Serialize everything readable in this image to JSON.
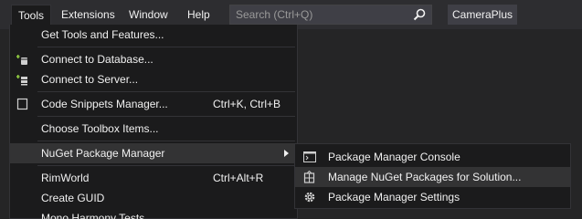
{
  "menubar": {
    "items": [
      {
        "label": "Tools"
      },
      {
        "label": "Extensions"
      },
      {
        "label": "Window"
      },
      {
        "label": "Help"
      }
    ],
    "search_placeholder": "Search (Ctrl+Q)",
    "profile_label": "CameraPlus"
  },
  "tools_menu": {
    "items": [
      {
        "label": "Get Tools and Features...",
        "shortcut": ""
      },
      {
        "label": "Connect to Database...",
        "shortcut": ""
      },
      {
        "label": "Connect to Server...",
        "shortcut": ""
      },
      {
        "label": "Code Snippets Manager...",
        "shortcut": "Ctrl+K, Ctrl+B"
      },
      {
        "label": "Choose Toolbox Items...",
        "shortcut": ""
      },
      {
        "label": "NuGet Package Manager",
        "shortcut": ""
      },
      {
        "label": "RimWorld",
        "shortcut": "Ctrl+Alt+R"
      },
      {
        "label": "Create GUID",
        "shortcut": ""
      },
      {
        "label": "Mono.Harmony Tests",
        "shortcut": ""
      }
    ]
  },
  "nuget_submenu": {
    "items": [
      {
        "label": "Package Manager Console",
        "icon": "console-icon"
      },
      {
        "label": "Manage NuGet Packages for Solution...",
        "icon": "nuget-package-icon"
      },
      {
        "label": "Package Manager Settings",
        "icon": "gear-icon"
      }
    ]
  },
  "colors": {
    "menubar_bg": "#2d2d30",
    "menu_bg": "#1b1b1c",
    "highlight": "#333334",
    "text": "#f1f1f1"
  }
}
